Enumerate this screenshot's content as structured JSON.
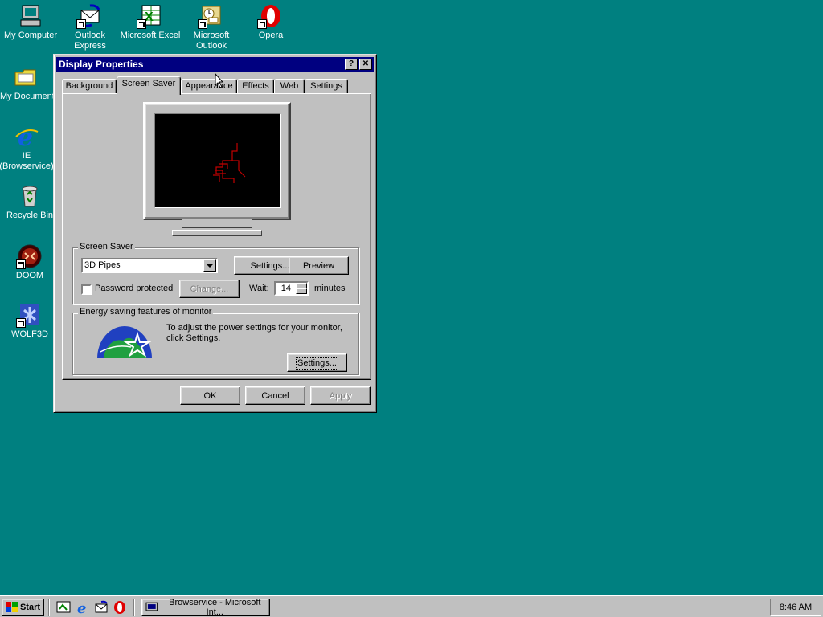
{
  "desktop": {
    "icons": [
      {
        "label": "My Computer",
        "icon": "my-computer-icon"
      },
      {
        "label": "Outlook Express",
        "icon": "outlook-express-icon"
      },
      {
        "label": "Microsoft Excel",
        "icon": "excel-icon"
      },
      {
        "label": "Microsoft Outlook",
        "icon": "outlook-icon"
      },
      {
        "label": "Opera",
        "icon": "opera-icon"
      },
      {
        "label": "My Documents",
        "icon": "folder-icon"
      },
      {
        "label": "IE (Browservice)",
        "icon": "ie-icon"
      },
      {
        "label": "Recycle Bin",
        "icon": "recycle-bin-icon"
      },
      {
        "label": "DOOM",
        "icon": "doom-icon"
      },
      {
        "label": "WOLF3D",
        "icon": "wolf3d-icon"
      }
    ]
  },
  "dialog": {
    "title": "Display Properties",
    "help_btn": "?",
    "close_btn": "✕",
    "tabs": [
      {
        "label": "Background"
      },
      {
        "label": "Screen Saver"
      },
      {
        "label": "Appearance"
      },
      {
        "label": "Effects"
      },
      {
        "label": "Web"
      },
      {
        "label": "Settings"
      }
    ],
    "active_tab": "Screen Saver",
    "screensaver": {
      "group_label": "Screen Saver",
      "selected": "3D Pipes",
      "settings_btn": "Settings...",
      "preview_btn": "Preview",
      "password_label": "Password protected",
      "password_checked": false,
      "change_btn": "Change...",
      "wait_label": "Wait:",
      "wait_value": "14",
      "minutes_label": "minutes"
    },
    "energy": {
      "group_label": "Energy saving features of monitor",
      "text": "To adjust the power settings for your monitor, click Settings.",
      "settings_btn": "Settings..."
    },
    "ok_btn": "OK",
    "cancel_btn": "Cancel",
    "apply_btn": "Apply"
  },
  "taskbar": {
    "start_label": "Start",
    "task_label": "Browservice - Microsoft Int...",
    "clock": "8:46 AM"
  },
  "colors": {
    "desktop": "#008080",
    "titlebar": "#000080",
    "face": "#c0c0c0"
  }
}
